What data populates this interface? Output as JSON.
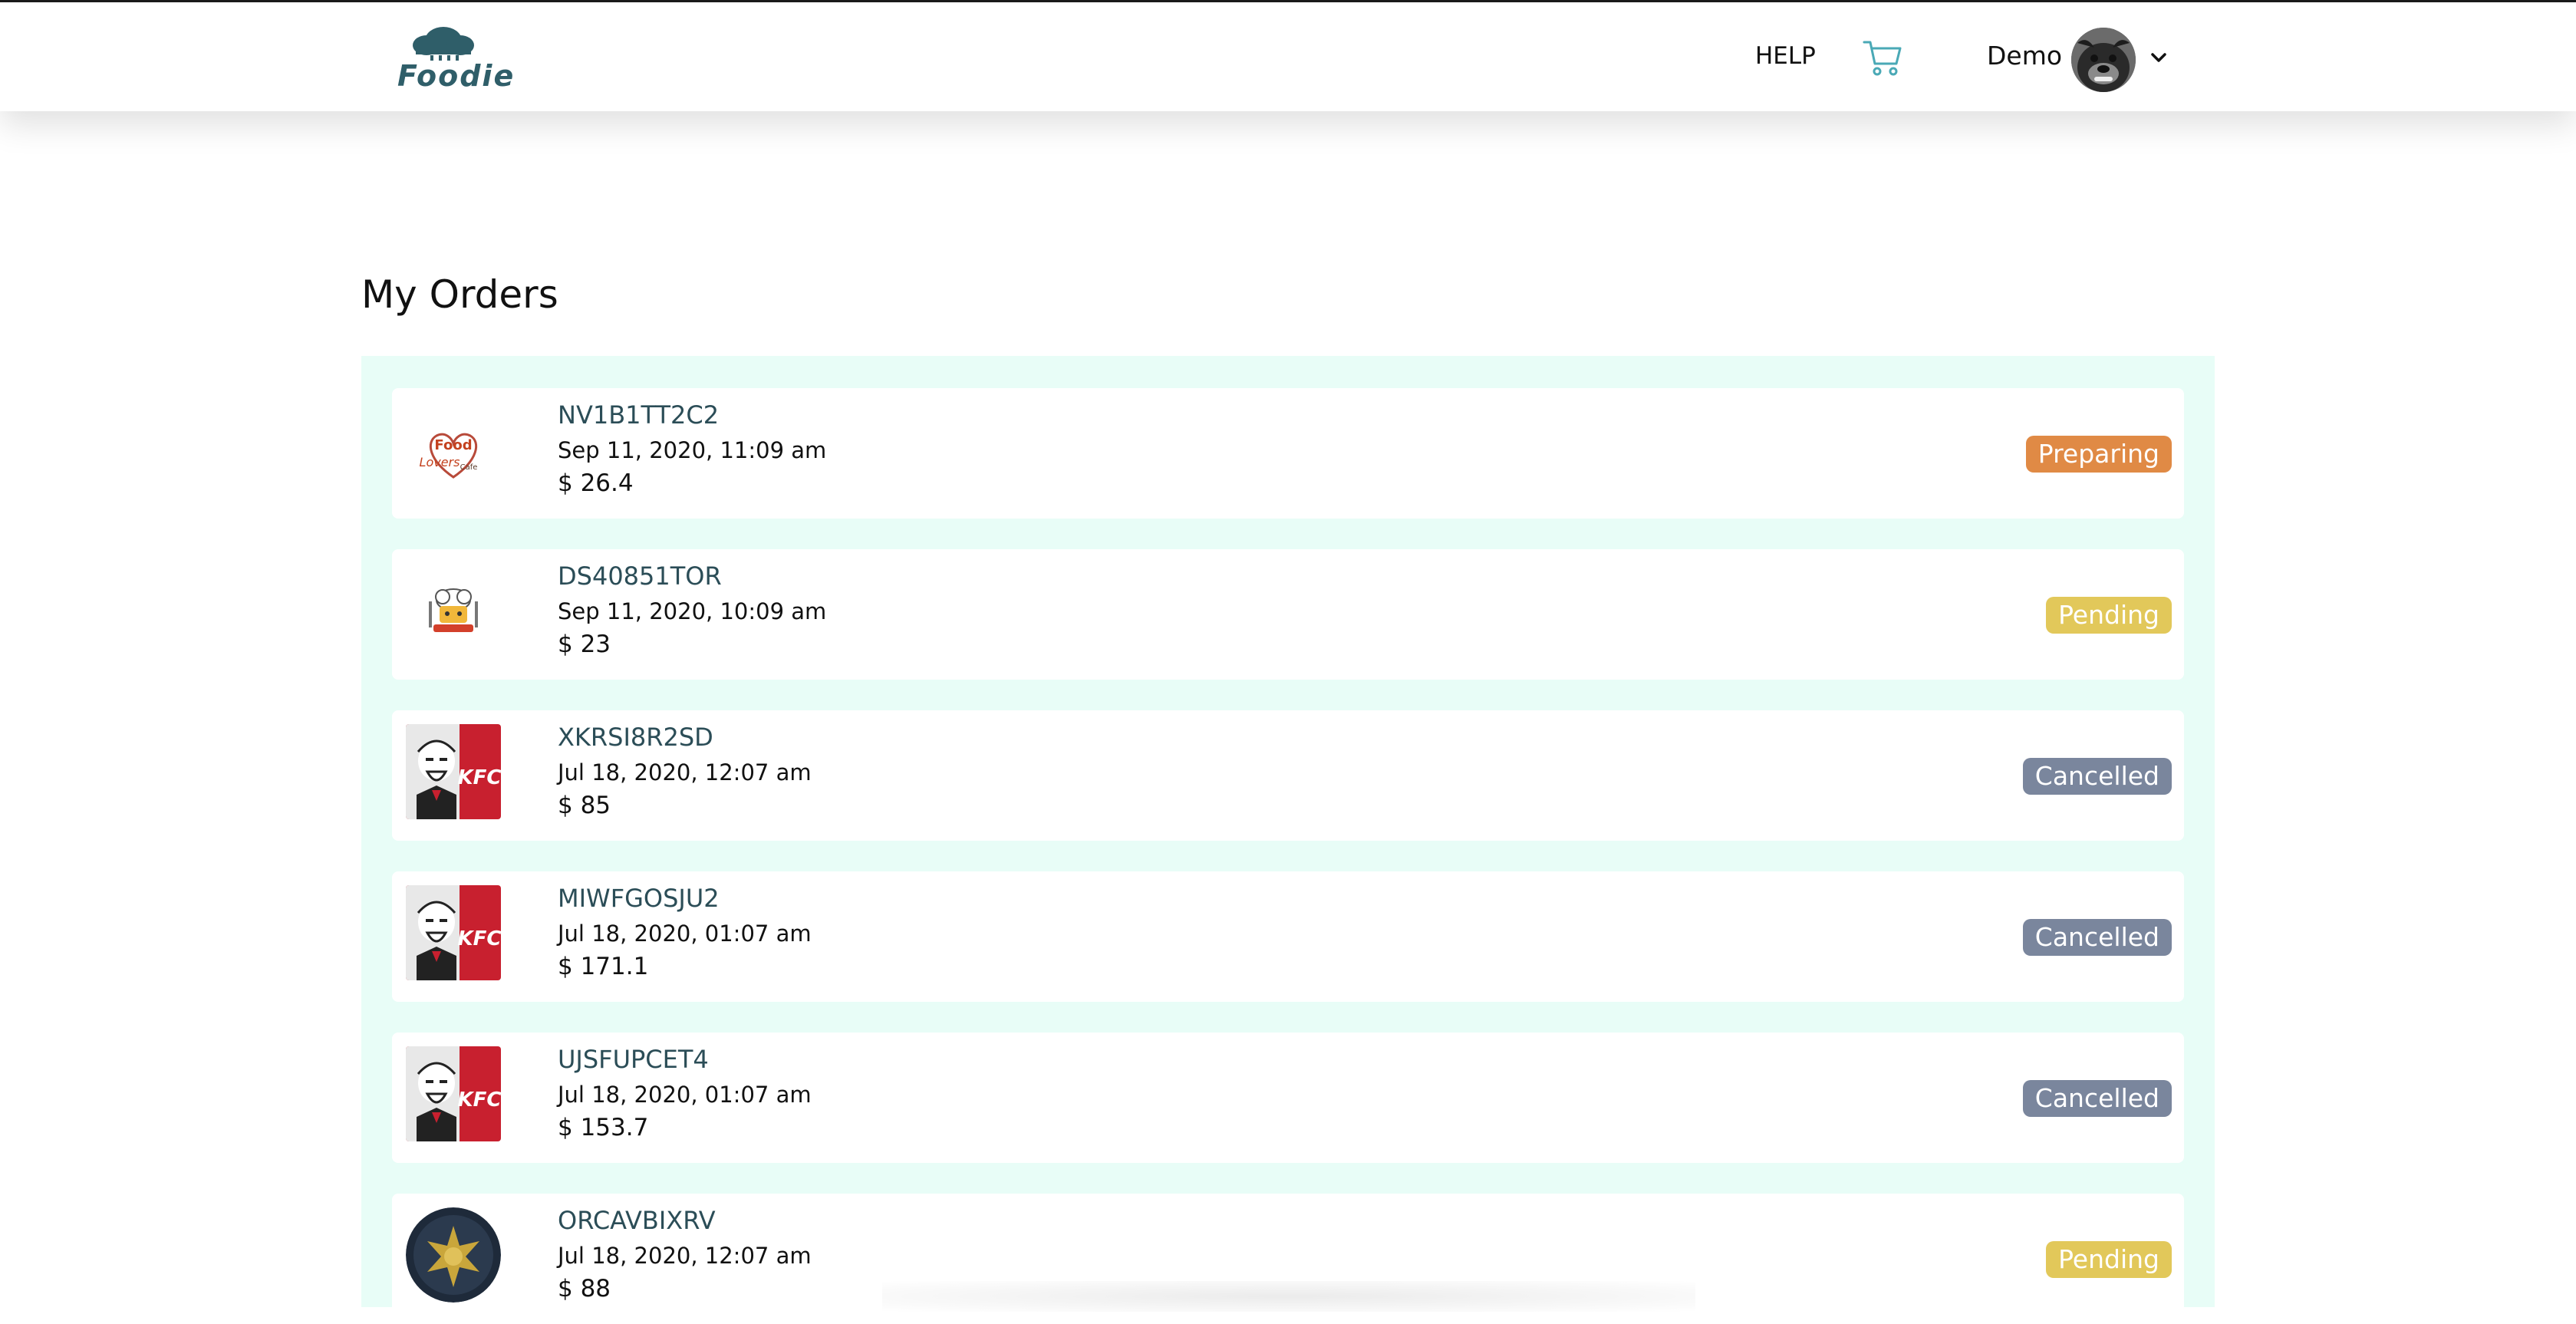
{
  "header": {
    "brand": "Foodie",
    "help_label": "HELP",
    "user_name": "Demo"
  },
  "page": {
    "title": "My Orders"
  },
  "colors": {
    "brand": "#2f5e69",
    "panel_bg": "#e8fdf7",
    "preparing": "#e08a45",
    "pending": "#e2c85a",
    "cancelled": "#7a869d",
    "cart": "#4aa9b6"
  },
  "orders": [
    {
      "id": "NV1B1TT2C2",
      "date": "Sep 11, 2020, 11:09 am",
      "total": "$ 26.4",
      "status": "Preparing",
      "status_color": "#e08a45",
      "logo": "food-lovers-logo"
    },
    {
      "id": "DS40851TOR",
      "date": "Sep 11, 2020, 10:09 am",
      "total": "$ 23",
      "status": "Pending",
      "status_color": "#e2c85a",
      "logo": "chef-logo"
    },
    {
      "id": "XKRSI8R2SD",
      "date": "Jul 18, 2020, 12:07 am",
      "total": "$ 85",
      "status": "Cancelled",
      "status_color": "#7a869d",
      "logo": "kfc-logo"
    },
    {
      "id": "MIWFGOSJU2",
      "date": "Jul 18, 2020, 01:07 am",
      "total": "$ 171.1",
      "status": "Cancelled",
      "status_color": "#7a869d",
      "logo": "kfc-logo"
    },
    {
      "id": "UJSFUPCET4",
      "date": "Jul 18, 2020, 01:07 am",
      "total": "$ 153.7",
      "status": "Cancelled",
      "status_color": "#7a869d",
      "logo": "kfc-logo"
    },
    {
      "id": "ORCAVBIXRV",
      "date": "Jul 18, 2020, 12:07 am",
      "total": "$ 88",
      "status": "Pending",
      "status_color": "#e2c85a",
      "logo": "badge-logo"
    }
  ]
}
